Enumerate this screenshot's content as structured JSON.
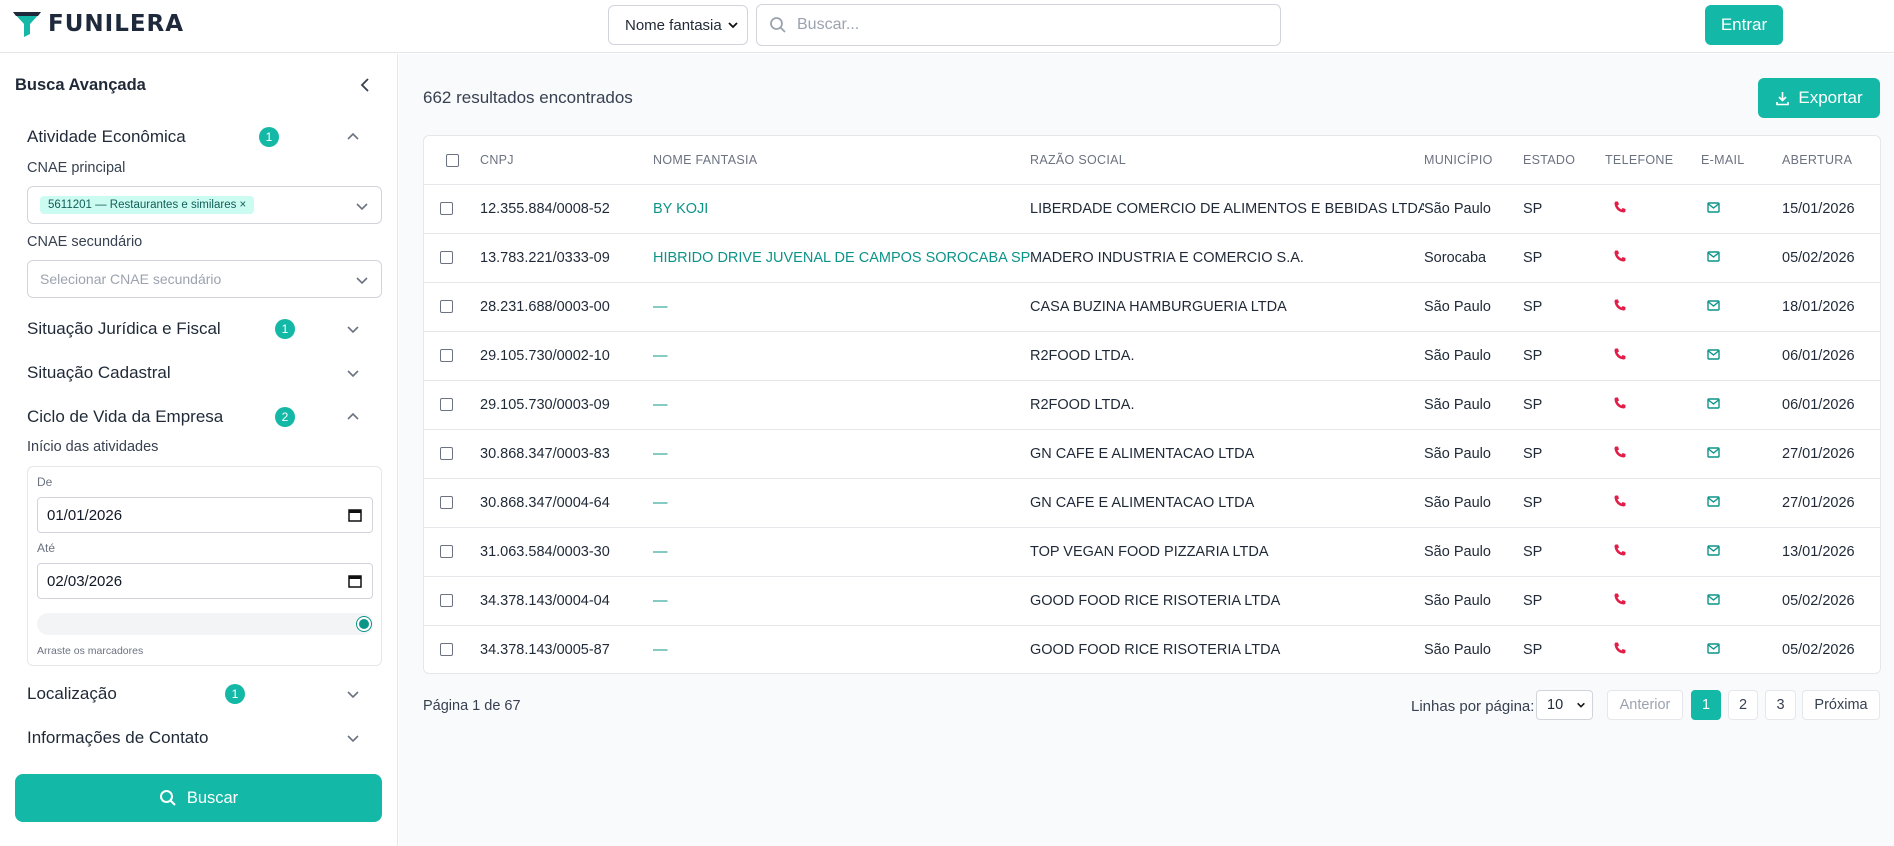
{
  "header": {
    "brand": "FUNILERA",
    "search_mode": "Nome fantasia",
    "search_placeholder": "Buscar...",
    "login_label": "Entrar"
  },
  "sidebar": {
    "title": "Busca Avançada",
    "sections": {
      "atividade": {
        "label": "Atividade Econômica",
        "badge": "1"
      },
      "juridica": {
        "label": "Situação Jurídica e Fiscal",
        "badge": "1"
      },
      "cadastral": {
        "label": "Situação Cadastral"
      },
      "ciclo": {
        "label": "Ciclo de Vida da Empresa",
        "badge": "2"
      },
      "localizacao": {
        "label": "Localização",
        "badge": "1"
      },
      "contato": {
        "label": "Informações de Contato"
      }
    },
    "cnae_principal_label": "CNAE principal",
    "cnae_principal_chip": "5611201 — Restaurantes e similares ×",
    "cnae_secundario_label": "CNAE secundário",
    "cnae_secundario_placeholder": "Selecionar CNAE secundário",
    "inicio_label": "Início das atividades",
    "de_label": "De",
    "de_value": "01/01/2026",
    "ate_label": "Até",
    "ate_value": "02/03/2026",
    "slider_hint": "Arraste os marcadores",
    "search_button": "Buscar"
  },
  "main": {
    "results_count": "662 resultados encontrados",
    "export_label": "Exportar",
    "columns": [
      "CNPJ",
      "NOME FANTASIA",
      "RAZÃO SOCIAL",
      "MUNICÍPIO",
      "ESTADO",
      "TELEFONE",
      "E-MAIL",
      "ABERTURA"
    ],
    "rows": [
      {
        "cnpj": "12.355.884/0008-52",
        "fantasia": "BY KOJI",
        "razao": "LIBERDADE COMERCIO DE ALIMENTOS E BEBIDAS LTDA.",
        "municipio": "São Paulo",
        "estado": "SP",
        "abertura": "15/01/2026"
      },
      {
        "cnpj": "13.783.221/0333-09",
        "fantasia": "HIBRIDO DRIVE JUVENAL DE CAMPOS SOROCABA SP",
        "razao": "MADERO INDUSTRIA E COMERCIO S.A.",
        "municipio": "Sorocaba",
        "estado": "SP",
        "abertura": "05/02/2026"
      },
      {
        "cnpj": "28.231.688/0003-00",
        "fantasia": "—",
        "razao": "CASA BUZINA HAMBURGUERIA LTDA",
        "municipio": "São Paulo",
        "estado": "SP",
        "abertura": "18/01/2026"
      },
      {
        "cnpj": "29.105.730/0002-10",
        "fantasia": "—",
        "razao": "R2FOOD LTDA.",
        "municipio": "São Paulo",
        "estado": "SP",
        "abertura": "06/01/2026"
      },
      {
        "cnpj": "29.105.730/0003-09",
        "fantasia": "—",
        "razao": "R2FOOD LTDA.",
        "municipio": "São Paulo",
        "estado": "SP",
        "abertura": "06/01/2026"
      },
      {
        "cnpj": "30.868.347/0003-83",
        "fantasia": "—",
        "razao": "GN CAFE E ALIMENTACAO LTDA",
        "municipio": "São Paulo",
        "estado": "SP",
        "abertura": "27/01/2026"
      },
      {
        "cnpj": "30.868.347/0004-64",
        "fantasia": "—",
        "razao": "GN CAFE E ALIMENTACAO LTDA",
        "municipio": "São Paulo",
        "estado": "SP",
        "abertura": "27/01/2026"
      },
      {
        "cnpj": "31.063.584/0003-30",
        "fantasia": "—",
        "razao": "TOP VEGAN FOOD PIZZARIA LTDA",
        "municipio": "São Paulo",
        "estado": "SP",
        "abertura": "13/01/2026"
      },
      {
        "cnpj": "34.378.143/0004-04",
        "fantasia": "—",
        "razao": "GOOD FOOD RICE RISOTERIA LTDA",
        "municipio": "São Paulo",
        "estado": "SP",
        "abertura": "05/02/2026"
      },
      {
        "cnpj": "34.378.143/0005-87",
        "fantasia": "—",
        "razao": "GOOD FOOD RICE RISOTERIA LTDA",
        "municipio": "São Paulo",
        "estado": "SP",
        "abertura": "05/02/2026"
      }
    ],
    "page_info": "Página 1 de 67",
    "rows_per_page_label": "Linhas por página:",
    "rows_per_page": "10",
    "prev_label": "Anterior",
    "pages": [
      "1",
      "2",
      "3"
    ],
    "next_label": "Próxima"
  },
  "colors": {
    "accent": "#14b8a6",
    "phone_icon": "#e11d48",
    "mail_icon": "#0d9488"
  }
}
